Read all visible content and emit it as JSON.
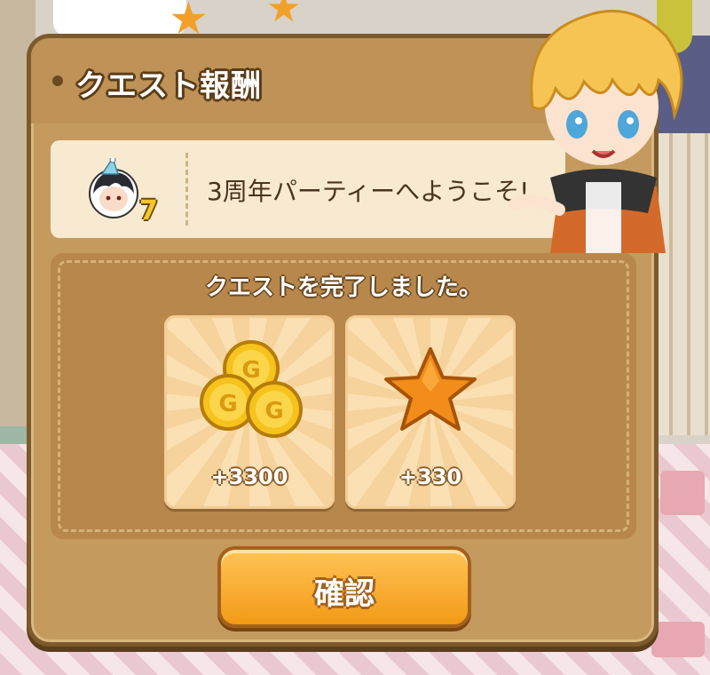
{
  "dialog": {
    "title": "クエスト報酬",
    "quest": {
      "name": "3周年パーティーへようこそ!",
      "level": "7"
    },
    "message": "クエストを完了しました。",
    "rewards": [
      {
        "icon": "gold-coins-icon",
        "amount": "+3300"
      },
      {
        "icon": "star-icon",
        "amount": "+330"
      }
    ],
    "confirm_label": "確認"
  },
  "colors": {
    "panel": "#c49a5e",
    "panel_border": "#7c5a2c",
    "banner": "#f8ead0",
    "button": "#f5a623",
    "coin": "#f6c21c",
    "star": "#f28c1a"
  }
}
